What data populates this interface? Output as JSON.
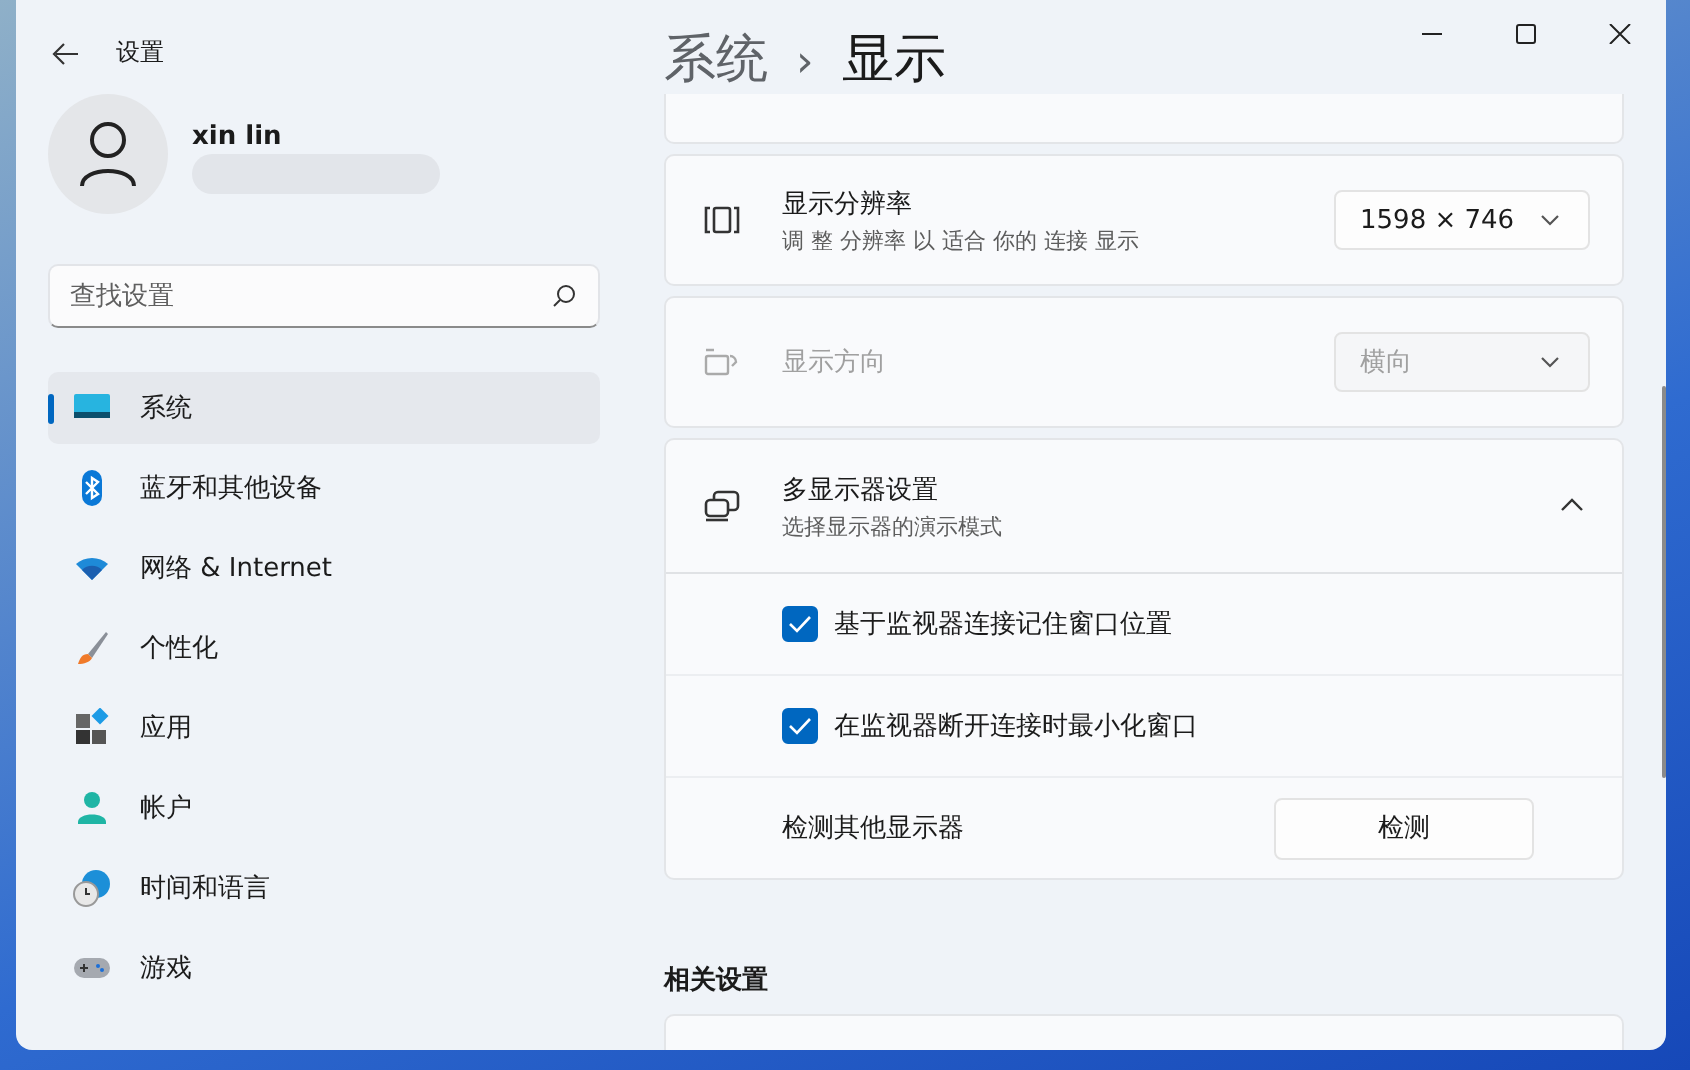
{
  "window": {
    "title": "设置"
  },
  "user": {
    "name": "xin lin"
  },
  "search": {
    "placeholder": "查找设置"
  },
  "sidebar": {
    "items": [
      {
        "label": "系统",
        "selected": true
      },
      {
        "label": "蓝牙和其他设备",
        "selected": false
      },
      {
        "label": "网络 & Internet",
        "selected": false
      },
      {
        "label": "个性化",
        "selected": false
      },
      {
        "label": "应用",
        "selected": false
      },
      {
        "label": "帐户",
        "selected": false
      },
      {
        "label": "时间和语言",
        "selected": false
      },
      {
        "label": "游戏",
        "selected": false
      }
    ]
  },
  "breadcrumb": {
    "parent": "系统",
    "separator": "›",
    "current": "显示"
  },
  "settings": [
    {
      "kind": "partial"
    },
    {
      "kind": "dropdown",
      "title": "显示分辨率",
      "subtitle": "调 整 分辨率 以 适合 你的 连接 显示",
      "value": "1598 × 746",
      "disabled": false
    },
    {
      "kind": "dropdown",
      "title": "显示方向",
      "value": "横向",
      "disabled": true
    },
    {
      "kind": "expander",
      "title": "多显示器设置",
      "subtitle": "选择显示器的演示模式",
      "expanded": true,
      "children": [
        {
          "kind": "checkbox",
          "label": "基于监视器连接记住窗口位置",
          "checked": true
        },
        {
          "kind": "checkbox",
          "label": "在监视器断开连接时最小化窗口",
          "checked": true
        },
        {
          "kind": "button",
          "label": "检测其他显示器",
          "button": "检测"
        }
      ]
    }
  ],
  "related": {
    "heading": "相关设置"
  }
}
